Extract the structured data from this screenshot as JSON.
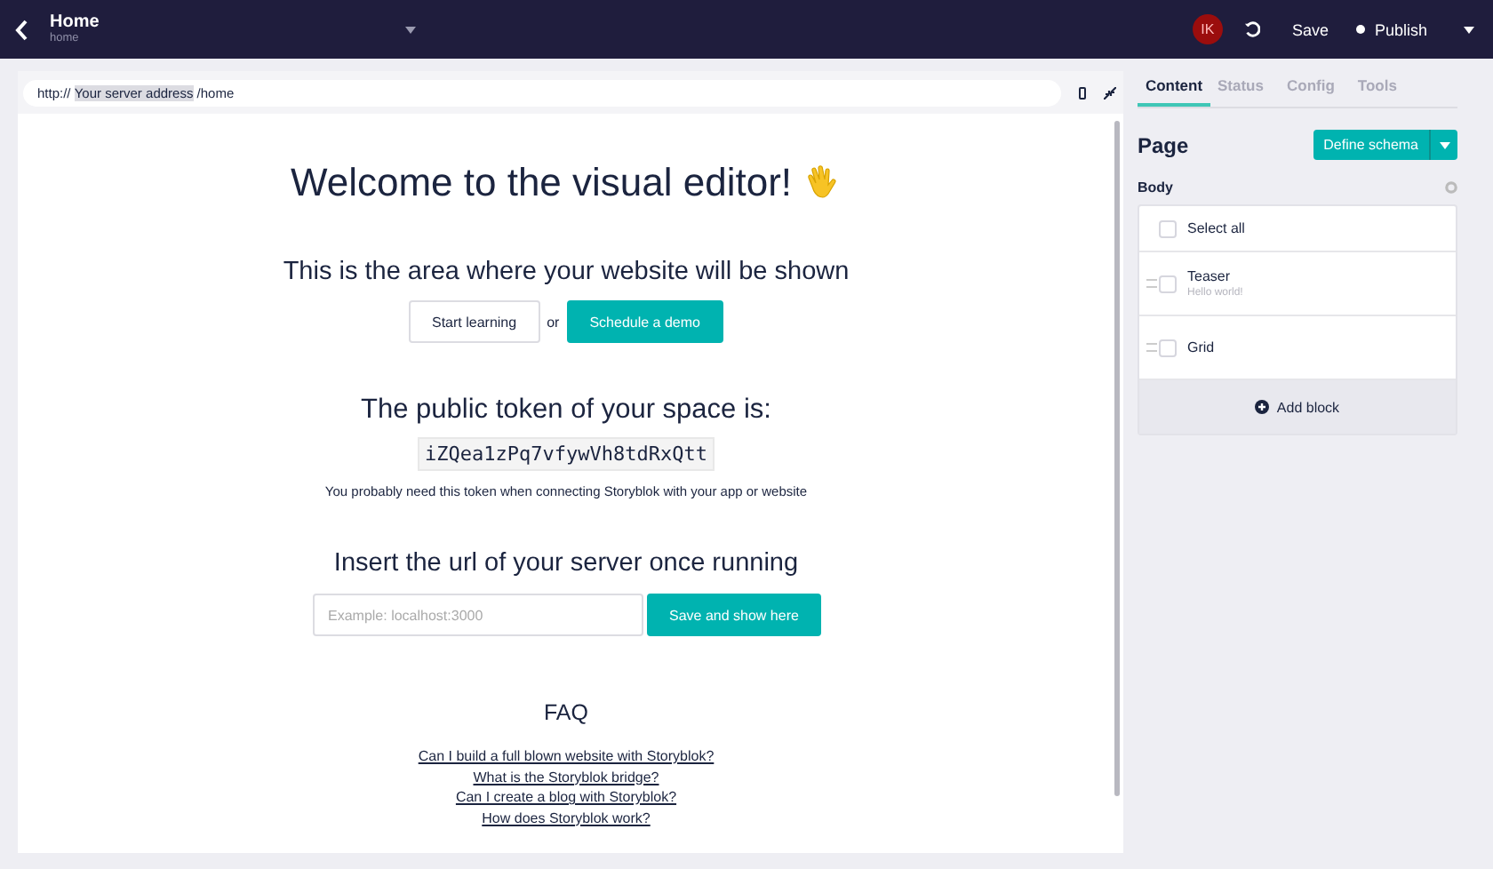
{
  "topbar": {
    "title": "Home",
    "slug": "home",
    "avatar": "IK",
    "save": "Save",
    "publish": "Publish"
  },
  "preview": {
    "url": {
      "scheme": "http://",
      "host": "Your server address",
      "path": "/home"
    },
    "heading": "Welcome to the visual editor!",
    "subheading": "This is the area where your website will be shown",
    "buttons": [
      {
        "label": "Start learning",
        "kind": "outline"
      },
      {
        "label": "Schedule a demo",
        "kind": "primary"
      }
    ],
    "or": "or",
    "token_heading": "The public token of your space is:",
    "token": "iZQea1zPq7vfywVh8tdRxQtt",
    "token_note": "You probably need this token when connecting Storyblok with your app or website",
    "server_heading": "Insert the url of your server once running",
    "server_field": {
      "placeholder": "Example: localhost:3000"
    },
    "server_button": "Save and show here",
    "faq_title": "FAQ",
    "faq_links": [
      "Can I build a full blown website with Storyblok?",
      "What is the Storyblok bridge?",
      "Can I create a blog with Storyblok?",
      "How does Storyblok work?"
    ]
  },
  "sidebar": {
    "tabs": [
      {
        "label": "Content",
        "selected": true
      },
      {
        "label": "Status",
        "selected": false
      },
      {
        "label": "Config",
        "selected": false
      },
      {
        "label": "Tools",
        "selected": false
      }
    ],
    "page_title": "Page",
    "define_schema": "Define schema",
    "section": "Body",
    "select_all": {
      "label": "Select all",
      "checked": false
    },
    "blocks": [
      {
        "name": "Teaser",
        "subtitle": "Hello world!",
        "checked": false
      },
      {
        "name": "Grid",
        "checked": false
      }
    ],
    "add_block": "Add block"
  }
}
